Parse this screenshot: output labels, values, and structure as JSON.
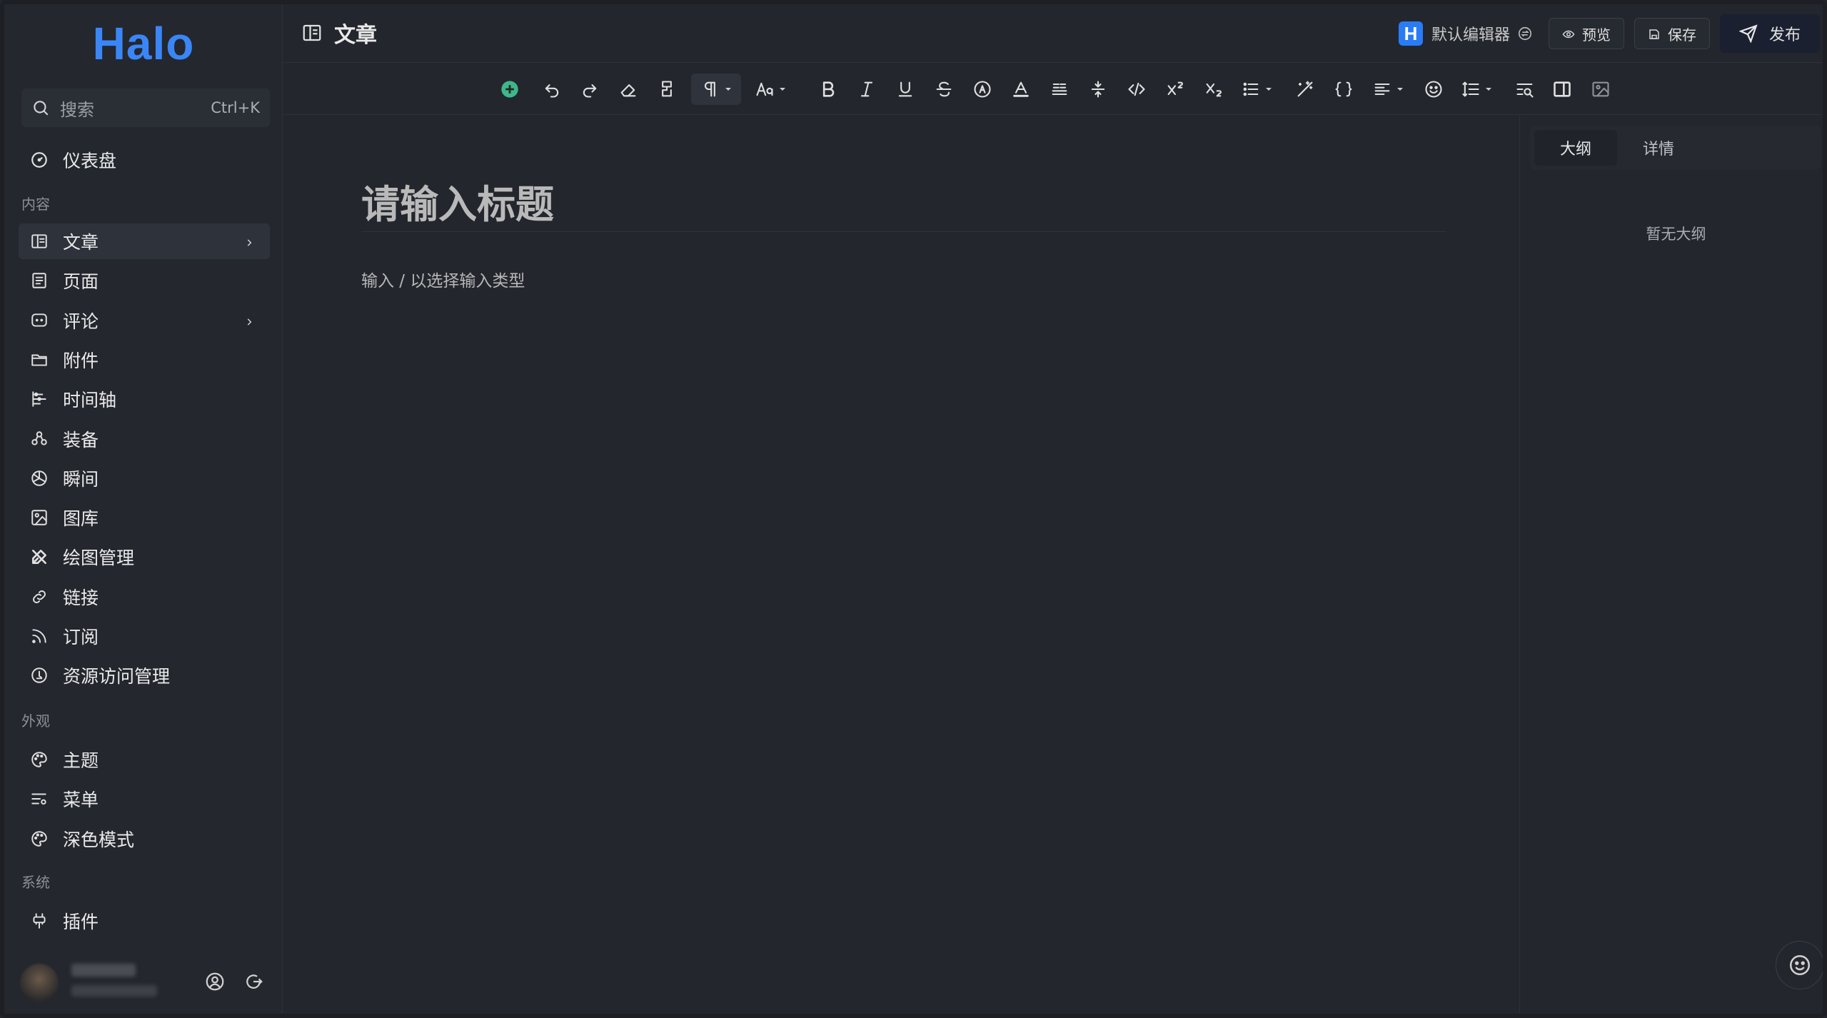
{
  "app": {
    "logo": "Halo"
  },
  "search": {
    "placeholder": "搜索",
    "shortcut": "Ctrl+K"
  },
  "sidebar": {
    "dashboard": "仪表盘",
    "groups": {
      "content": "内容",
      "appearance": "外观",
      "system": "系统"
    },
    "content_items": [
      {
        "label": "文章",
        "icon": "article-icon",
        "active": true,
        "expandable": true
      },
      {
        "label": "页面",
        "icon": "page-icon"
      },
      {
        "label": "评论",
        "icon": "comment-icon",
        "expandable": true
      },
      {
        "label": "附件",
        "icon": "folder-icon"
      },
      {
        "label": "时间轴",
        "icon": "timeline-icon"
      },
      {
        "label": "装备",
        "icon": "equipment-icon"
      },
      {
        "label": "瞬间",
        "icon": "moment-icon"
      },
      {
        "label": "图库",
        "icon": "gallery-icon"
      },
      {
        "label": "绘图管理",
        "icon": "drawing-icon"
      },
      {
        "label": "链接",
        "icon": "link-icon"
      },
      {
        "label": "订阅",
        "icon": "rss-icon"
      },
      {
        "label": "资源访问管理",
        "icon": "resource-icon"
      }
    ],
    "appearance_items": [
      {
        "label": "主题",
        "icon": "palette-icon"
      },
      {
        "label": "菜单",
        "icon": "menu-icon"
      },
      {
        "label": "深色模式",
        "icon": "palette-icon"
      }
    ],
    "system_items": [
      {
        "label": "插件",
        "icon": "plugin-icon"
      }
    ]
  },
  "header": {
    "title": "文章",
    "editor_badge": "H",
    "editor_name": "默认编辑器",
    "preview": "预览",
    "save": "保存",
    "publish": "发布"
  },
  "toolbar": {
    "icons": [
      "add-block-icon",
      "undo-icon",
      "redo-icon",
      "eraser-icon",
      "format-painter-icon",
      "paragraph-icon",
      "font-size-icon",
      "bold-icon",
      "italic-icon",
      "underline-icon",
      "strike-icon",
      "mention-icon",
      "text-color-icon",
      "highlight-icon",
      "line-height-icon",
      "code-icon",
      "superscript-icon",
      "subscript-icon",
      "list-icon",
      "magic-icon",
      "code-block-icon",
      "align-icon",
      "emoji-icon",
      "line-spacing-icon",
      "search-replace-icon",
      "sidebar-toggle-icon",
      "image-icon"
    ]
  },
  "editor": {
    "title_placeholder": "请输入标题",
    "body_placeholder": "输入 / 以选择输入类型"
  },
  "rpanel": {
    "tabs": [
      "大纲",
      "详情"
    ],
    "empty": "暂无大纲"
  },
  "colors": {
    "brand": "#3a86f7",
    "accent_green": "#3fb68b",
    "bg": "#23262d"
  }
}
